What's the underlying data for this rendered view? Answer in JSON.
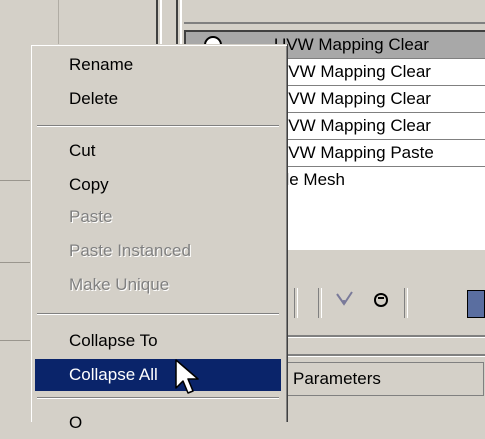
{
  "stack": {
    "items": [
      {
        "label": "UVW Mapping Clear"
      },
      {
        "label": "UVW Mapping Clear"
      },
      {
        "label": "UVW Mapping Clear"
      },
      {
        "label": "UVW Mapping Clear"
      },
      {
        "label": "UVW Mapping Paste"
      },
      {
        "label": "ble Mesh"
      }
    ]
  },
  "context_menu": {
    "items": [
      {
        "label": "Rename",
        "enabled": true
      },
      {
        "label": "Delete",
        "enabled": true
      },
      {
        "label": "Cut",
        "enabled": true
      },
      {
        "label": "Copy",
        "enabled": true
      },
      {
        "label": "Paste",
        "enabled": false
      },
      {
        "label": "Paste Instanced",
        "enabled": false
      },
      {
        "label": "Make Unique",
        "enabled": false
      },
      {
        "label": "Collapse To",
        "enabled": true
      },
      {
        "label": "Collapse All",
        "enabled": true,
        "highlighted": true
      },
      {
        "label": "O",
        "enabled": true
      }
    ]
  },
  "rollout": {
    "title": "Parameters"
  },
  "colors": {
    "face": "#d4d0c8",
    "highlight": "#0a246a",
    "selected_row": "#a8a8a8"
  }
}
